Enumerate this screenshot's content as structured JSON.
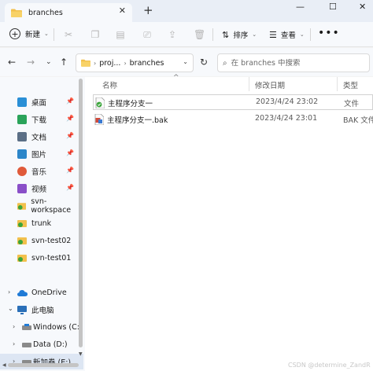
{
  "window": {
    "tab_title": "branches",
    "tab_close": "✕",
    "new_tab": "+",
    "minimize": "—",
    "maximize": "☐",
    "close": "✕"
  },
  "toolbar": {
    "new_label": "新建",
    "sort_label": "排序",
    "view_label": "查看",
    "more_label": "•••",
    "icons": [
      "scissors-icon",
      "copy-icon",
      "paste-icon",
      "rename-icon",
      "share-icon",
      "delete-icon"
    ]
  },
  "address": {
    "crumbs": [
      "proj...",
      "branches"
    ],
    "search_placeholder": "在 branches 中搜索"
  },
  "sidebar": {
    "quick_access": [
      {
        "label": "桌面",
        "icon": "desktop-icon",
        "color": "#2a8fd6"
      },
      {
        "label": "下载",
        "icon": "download-icon",
        "color": "#2aa35a"
      },
      {
        "label": "文档",
        "icon": "document-icon",
        "color": "#5b6f86"
      },
      {
        "label": "图片",
        "icon": "picture-icon",
        "color": "#2c86c9"
      },
      {
        "label": "音乐",
        "icon": "music-icon",
        "color": "#e05a3a"
      },
      {
        "label": "视频",
        "icon": "video-icon",
        "color": "#8a4fc8"
      }
    ],
    "folders": [
      "svn-workspace",
      "trunk",
      "svn-test02",
      "svn-test01"
    ],
    "onedrive": "OneDrive",
    "this_pc": "此电脑",
    "drives": [
      "Windows (C:)",
      "Data (D:)",
      "新加卷 (E:)"
    ]
  },
  "columns": {
    "name": "名称",
    "date": "修改日期",
    "type": "类型"
  },
  "files": [
    {
      "name": "主程序分支一",
      "date": "2023/4/24 23:02",
      "type": "文件"
    },
    {
      "name": "主程序分支一.bak",
      "date": "2023/4/24 23:01",
      "type": "BAK 文件"
    }
  ],
  "watermark": "CSDN @determine_ZandR"
}
